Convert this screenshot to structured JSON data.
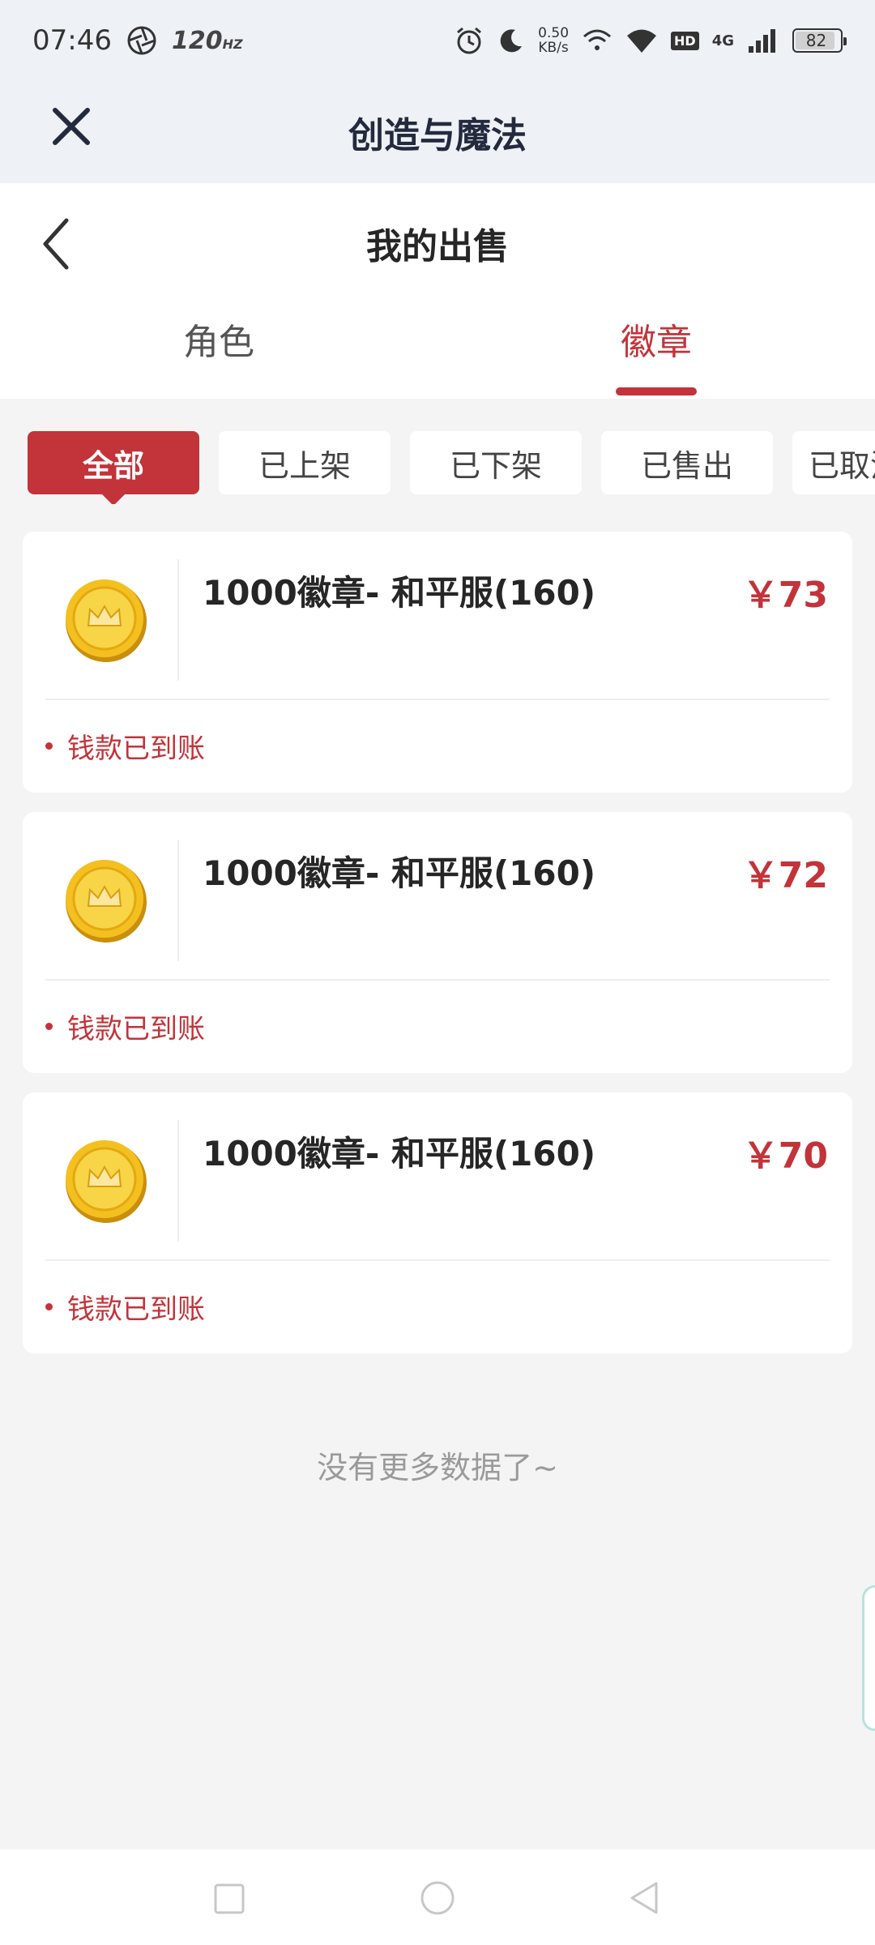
{
  "status_bar": {
    "time": "07:46",
    "refresh_rate": "120",
    "refresh_unit": "HZ",
    "net_speed_value": "0.50",
    "net_speed_unit": "KB/s",
    "hd_label": "HD",
    "network_type": "4G",
    "battery": "82"
  },
  "app_header": {
    "title": "创造与魔法",
    "close_icon": "close-icon"
  },
  "page": {
    "title": "我的出售",
    "back_icon": "chevron-left-icon"
  },
  "tabs": [
    {
      "label": "角色",
      "active": false
    },
    {
      "label": "徽章",
      "active": true
    }
  ],
  "filters": [
    {
      "label": "全部",
      "active": true
    },
    {
      "label": "已上架",
      "active": false
    },
    {
      "label": "已下架",
      "active": false
    },
    {
      "label": "已售出",
      "active": false
    },
    {
      "label": "已取消",
      "active": false
    }
  ],
  "orders": [
    {
      "title": "1000徽章- 和平服(160)",
      "price": "￥73",
      "status": "钱款已到账",
      "icon": "gold-coin-icon"
    },
    {
      "title": "1000徽章- 和平服(160)",
      "price": "￥72",
      "status": "钱款已到账",
      "icon": "gold-coin-icon"
    },
    {
      "title": "1000徽章- 和平服(160)",
      "price": "￥70",
      "status": "钱款已到账",
      "icon": "gold-coin-icon"
    }
  ],
  "footer_text": "没有更多数据了~",
  "colors": {
    "accent": "#c3333a",
    "header_bg": "#eef1f6",
    "page_bg": "#f4f4f5"
  }
}
